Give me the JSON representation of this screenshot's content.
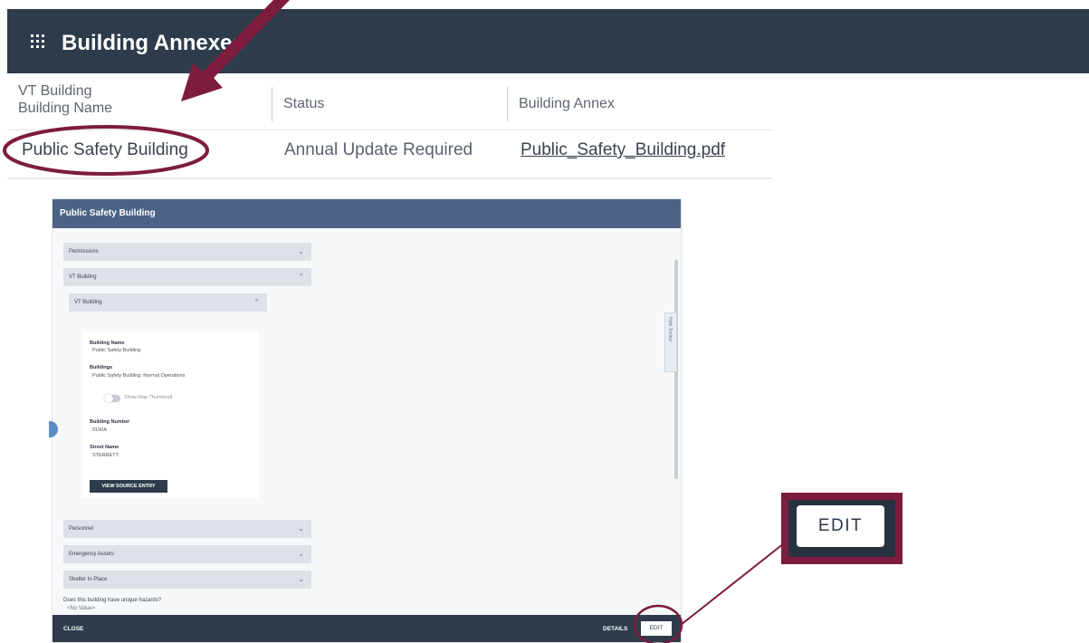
{
  "grid": {
    "title": "Building Annexes",
    "columns": [
      "VT Building\nBuilding Name",
      "Status",
      "Building Annex"
    ],
    "col1_line1": "VT Building",
    "col1_line2": "Building Name",
    "col2": "Status",
    "col3": "Building Annex",
    "rows": [
      {
        "name": "Public Safety Building",
        "status": "Annual Update Required",
        "annex": "Public_Safety_Building.pdf"
      }
    ]
  },
  "modal": {
    "title": "Public Safety Building",
    "sections": [
      {
        "label": "Permissions",
        "state": "collapsed"
      },
      {
        "label": "VT Building",
        "state": "expanded"
      },
      {
        "label": "VT Building",
        "state": "expanded"
      },
      {
        "label": "Personnel",
        "state": "collapsed"
      },
      {
        "label": "Emergency Assets",
        "state": "collapsed"
      },
      {
        "label": "Shelter In Place",
        "state": "collapsed"
      }
    ],
    "card": {
      "building_name_label": "Building Name",
      "building_name_value": "Public Safety Building",
      "buildings_label": "Buildings",
      "buildings_value": "Public Safety Building: Normal Operations",
      "map_toggle_label": "Show Map Thumbnail",
      "building_number_label": "Building Number",
      "building_number_value": "0190A",
      "street_name_label": "Street Name",
      "street_name_value": "STERRETT",
      "view_source_label": "VIEW SOURCE ENTRY"
    },
    "hazards_question": "Does this building have unique hazards?",
    "hazards_value": "<No Value>",
    "side_tab": "Hide Toolbar",
    "footer": {
      "close": "CLOSE",
      "details": "DETAILS",
      "edit": "EDIT"
    }
  },
  "callout": {
    "edit_label": "EDIT"
  },
  "colors": {
    "header": "#2e3b4b",
    "modal_header": "#4c6385",
    "annotation": "#7d1c3e"
  }
}
